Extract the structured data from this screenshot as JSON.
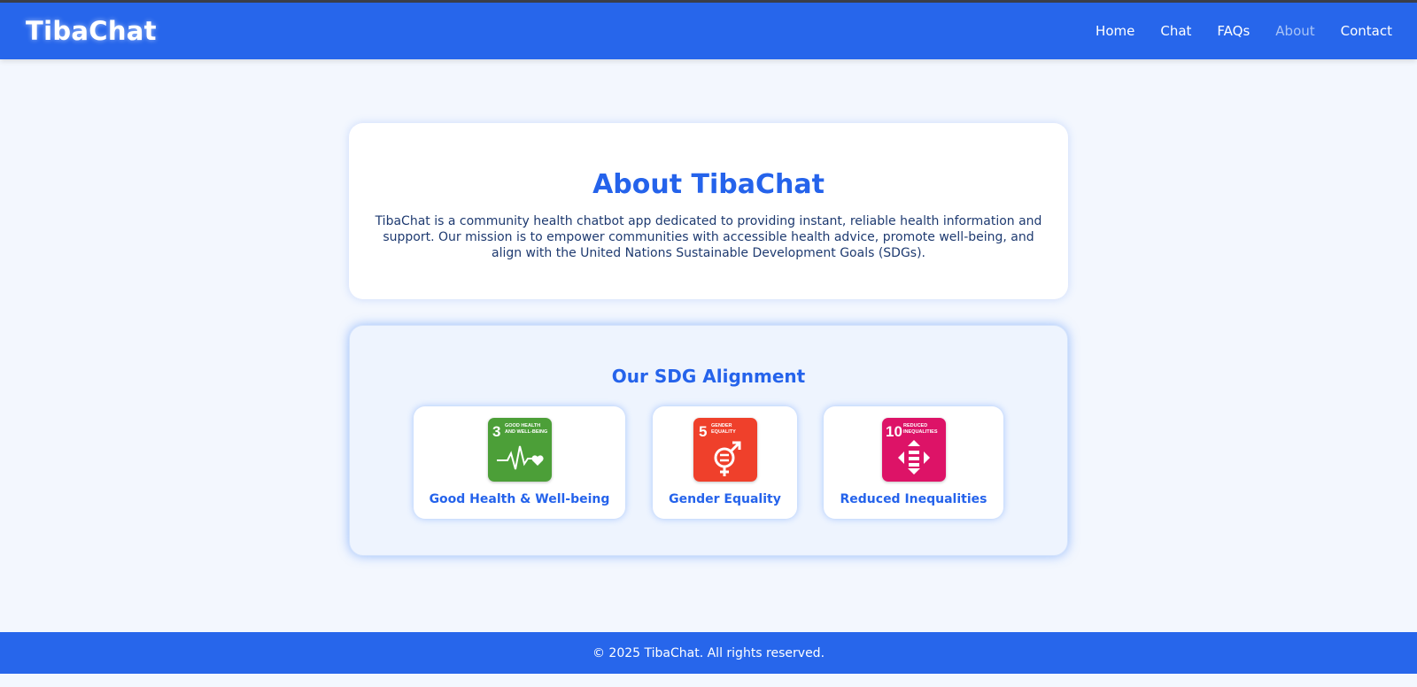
{
  "header": {
    "brand": "TibaChat",
    "nav": [
      "Home",
      "Chat",
      "FAQs",
      "About",
      "Contact"
    ],
    "active_nav": "About"
  },
  "about": {
    "title": "About TibaChat",
    "text": "TibaChat is a community health chatbot app dedicated to providing instant, reliable health information and support. Our mission is to empower communities with accessible health advice, promote well-being, and align with the United Nations Sustainable Development Goals (SDGs)."
  },
  "sdg": {
    "title": "Our SDG Alignment",
    "goals": [
      {
        "number": "3",
        "tile_text": [
          "GOOD HEALTH",
          "AND WELL-BEING"
        ],
        "label": "Good Health & Well-being",
        "color": "#4c9f38",
        "icon": "heartbeat-icon"
      },
      {
        "number": "5",
        "tile_text": [
          "GENDER",
          "EQUALITY"
        ],
        "label": "Gender Equality",
        "color": "#ef402b",
        "icon": "gender-equality-icon"
      },
      {
        "number": "10",
        "tile_text": [
          "REDUCED",
          "INEQUALITIES"
        ],
        "label": "Reduced Inequalities",
        "color": "#dd1367",
        "icon": "reduced-inequalities-icon"
      }
    ]
  },
  "footer": {
    "text": "© 2025 TibaChat. All rights reserved."
  },
  "colors": {
    "primary": "#2766eb",
    "background": "#f3f7fe"
  }
}
